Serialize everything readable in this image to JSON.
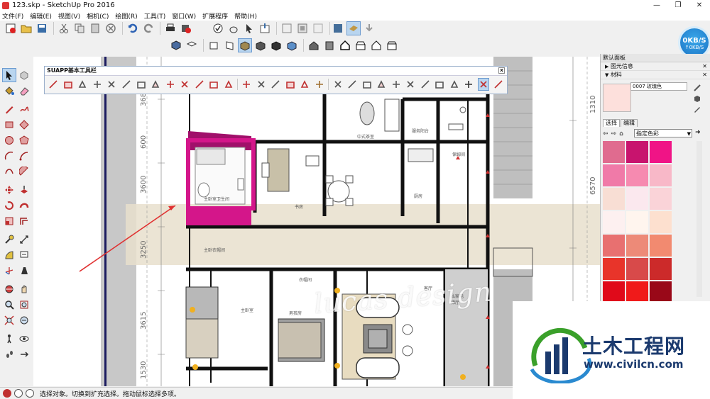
{
  "window": {
    "title": "123.skp - SketchUp Pro 2016",
    "minimize": "—",
    "maximize": "❐",
    "close": "✕"
  },
  "menu": [
    "文件(F)",
    "编辑(E)",
    "视图(V)",
    "相机(C)",
    "绘图(R)",
    "工具(T)",
    "窗口(W)",
    "扩展程序",
    "帮助(H)"
  ],
  "net_speed": {
    "down": "0KB/S",
    "up": "↑0KB/S"
  },
  "suapp": {
    "title": "SUAPP基本工具栏",
    "close": "x"
  },
  "dimensions": [
    "368",
    "600",
    "3600",
    "3250",
    "3615",
    "1530",
    "1310",
    "6570"
  ],
  "rooms": [
    "主卧室卫生间",
    "书房",
    "中式茶室",
    "服务阳台",
    "保姆间",
    "厨房",
    "主卧衣帽间",
    "衣帽间",
    "主卧室",
    "男孩房",
    "客厅",
    "私家电梯厅"
  ],
  "watermark": "lucas design",
  "panel": {
    "title": "默认面板",
    "entity_info": "图元信息",
    "materials": "材料",
    "material_name": "0007 玫瑰色",
    "tab_select": "选择",
    "tab_edit": "编辑",
    "library": "指定色彩"
  },
  "swatches": [
    "#e06b8f",
    "#c8146e",
    "#f01486",
    "#f07aa8",
    "#f68ab0",
    "#f8b8c8",
    "#f8ded4",
    "#fbe8ee",
    "#fad3d8",
    "#fdf0f0",
    "#fff5ee",
    "#fde0cf",
    "#e87070",
    "#ed8a78",
    "#f28a70",
    "#e8342a",
    "#d84a4a",
    "#cc2a2a",
    "#e00a1a",
    "#f01a1a",
    "#990818"
  ],
  "status": {
    "text": "选择对象。切换到扩充选择。拖动鼠标选择多项。"
  },
  "logo": {
    "main": "土木工程网",
    "sub": "www.civilcn.com"
  },
  "colors": {
    "accent_magenta": "#d4168a",
    "panel_bg": "#f0f0f0",
    "logo_blue": "#1b3a6e"
  }
}
